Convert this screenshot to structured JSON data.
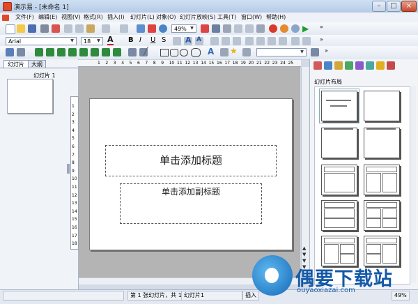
{
  "window": {
    "title": "演示易 - [未命名 1]"
  },
  "menu": [
    "文件(F)",
    "编辑(E)",
    "视图(V)",
    "格式(R)",
    "插入(I)",
    "幻灯片(L)",
    "对象(O)",
    "幻灯片放映(S)",
    "工具(T)",
    "窗口(W)",
    "帮助(H)"
  ],
  "toolbar": {
    "zoom": "49%",
    "font": "Arial",
    "font_size": "18"
  },
  "left_panel": {
    "tabs": [
      "幻灯片",
      "大纲"
    ],
    "thumb_label": "幻灯片 1"
  },
  "ruler": {
    "ticks": [
      "1",
      "2",
      "3",
      "4",
      "5",
      "6",
      "7",
      "8",
      "9",
      "10",
      "11",
      "12",
      "13",
      "14",
      "15",
      "16",
      "17",
      "18",
      "19",
      "20",
      "21",
      "22",
      "23",
      "24",
      "25"
    ],
    "v_ticks": [
      "1",
      "2",
      "3",
      "4",
      "5",
      "6",
      "7",
      "8",
      "9",
      "10",
      "11",
      "12",
      "13",
      "14",
      "15",
      "16",
      "17",
      "18"
    ]
  },
  "slide": {
    "title_placeholder": "单击添加标题",
    "subtitle_placeholder": "单击添加副标题"
  },
  "right_panel": {
    "title": "幻灯片布局"
  },
  "status": {
    "slide_pos": "第 1 张幻灯片，共 1",
    "slide_name": "幻灯片1",
    "mode": "插入",
    "zoom": "49%"
  },
  "watermark": {
    "name": "偶要下载站",
    "url": "ouyaoxiazai.com"
  }
}
